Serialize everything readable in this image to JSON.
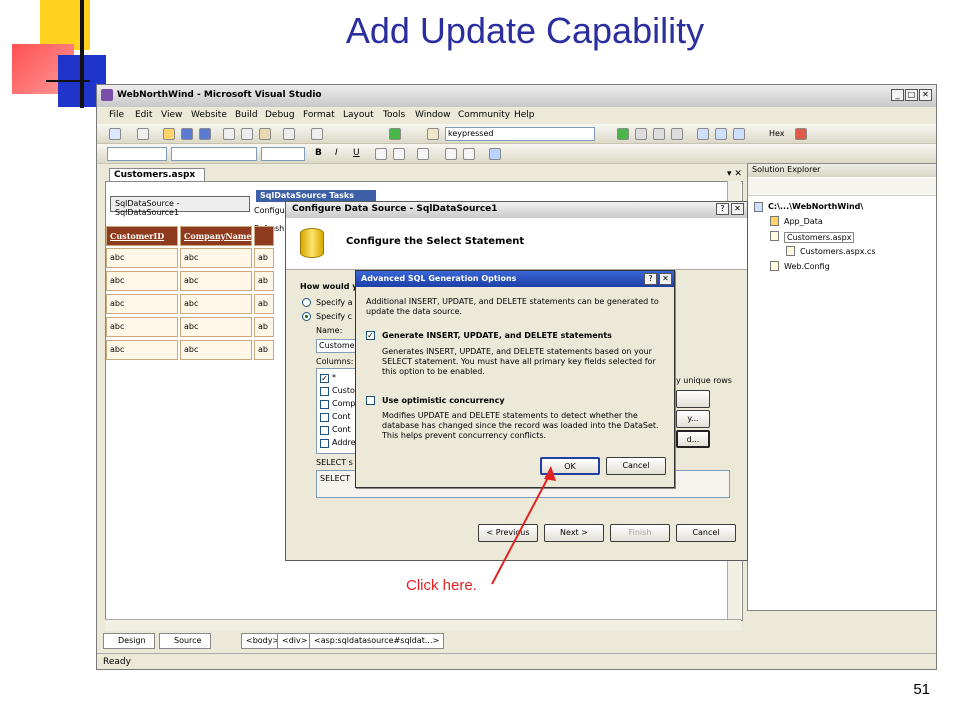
{
  "slide": {
    "title": "Add Update Capability",
    "page_number": "51",
    "annotation": "Click here."
  },
  "window": {
    "title": "WebNorthWind - Microsoft Visual Studio",
    "menu": [
      "File",
      "Edit",
      "View",
      "Website",
      "Build",
      "Debug",
      "Format",
      "Layout",
      "Tools",
      "Window",
      "Community",
      "Help"
    ],
    "toolbar_combo": "keypressed",
    "toolbar_hex": "Hex"
  },
  "document": {
    "tab": "Customers.aspx",
    "sds_control": "SqlDataSource - SqlDataSource1",
    "sds_tasks": "SqlDataSource Tasks",
    "sds_task_items": [
      "Configure",
      "Refresh"
    ],
    "grid_headers": [
      "CustomerID",
      "CompanyName"
    ],
    "grid_cell": "abc",
    "grid_third_col_cell": "ab"
  },
  "config_dialog": {
    "title": "Configure Data Source - SqlDataSource1",
    "heading": "Configure the Select Statement",
    "prompt": "How would y",
    "radio_a": "Specify a",
    "radio_b": "Specify c",
    "name_label": "Name:",
    "name_value": "Custome",
    "columns_label": "Columns:",
    "columns": [
      "*",
      "Custo",
      "Comp",
      "Cont",
      "Cont",
      "Addre"
    ],
    "unique_rows": "y unique rows",
    "side_btn_2": "y...",
    "side_btn_3": "d...",
    "select_label": "SELECT s",
    "select_value": "SELECT",
    "buttons": {
      "previous": "< Previous",
      "next": "Next >",
      "finish": "Finish",
      "cancel": "Cancel"
    }
  },
  "adv_dialog": {
    "title": "Advanced SQL Generation Options",
    "intro": "Additional INSERT, UPDATE, and DELETE statements can be generated to update the data source.",
    "option1_label": "Generate INSERT, UPDATE, and DELETE statements",
    "option1_desc": "Generates INSERT, UPDATE, and DELETE statements based on your SELECT statement. You must have all primary key fields selected for this option to be enabled.",
    "option2_label": "Use optimistic concurrency",
    "option2_desc": "Modifies UPDATE and DELETE statements to detect whether the database has changed since the record was loaded into the DataSet. This helps prevent concurrency conflicts.",
    "ok": "OK",
    "cancel": "Cancel"
  },
  "solution_explorer": {
    "title": "Solution Explorer",
    "root": "C:\\...\\WebNorthWind\\",
    "items": [
      "App_Data",
      "Customers.aspx",
      "Customers.aspx.cs",
      "Web.Config"
    ]
  },
  "bottom": {
    "design_tab": "Design",
    "source_tab": "Source",
    "breadcrumbs": [
      "<body>",
      "<div>",
      "<asp:sqldatasource#sqldat...>"
    ],
    "status": "Ready"
  },
  "colors": {
    "slide_title": "#2b2e9e",
    "annotation": "#e22222",
    "grid_header": "#8e3a1d",
    "adv_title_bar": "#1e3fa6"
  }
}
